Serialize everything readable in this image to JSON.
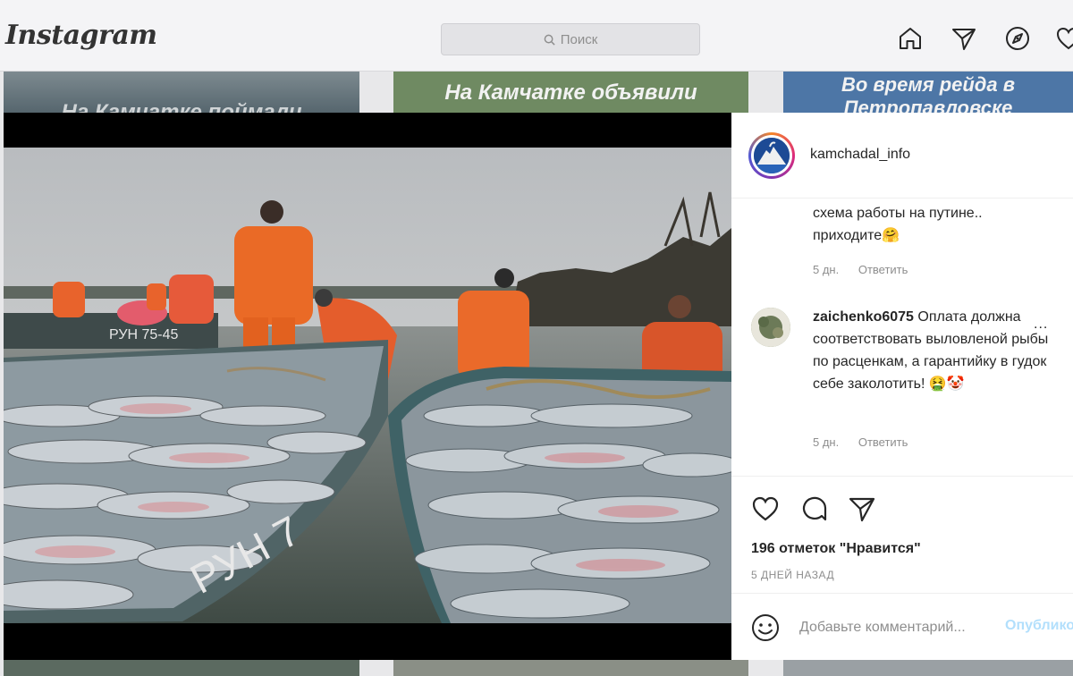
{
  "app": {
    "logo": "Instagram",
    "search_placeholder": "Поиск"
  },
  "nav": {
    "icons": [
      "home-icon",
      "direct-icon",
      "explore-icon",
      "heart-icon"
    ]
  },
  "background_tiles": [
    {
      "text": "На Камчатке поймали"
    },
    {
      "text": "На Камчатке объявили"
    },
    {
      "text": "Во время рейда в Петропавловске"
    }
  ],
  "post": {
    "username": "kamchadal_info",
    "comments": [
      {
        "username": "",
        "text_lines": [
          "схема работы на путине..",
          "приходите🤗"
        ],
        "time": "5 дн.",
        "reply": "Ответить"
      },
      {
        "username": "zaichenko6075",
        "text": "Оплата должна соответствовать выловленой рыбы по расценкам, а гарантийку в гудок себе заколотить! 🤮🤡",
        "time": "5 дн.",
        "reply": "Ответить"
      }
    ],
    "more": "...",
    "likes": "196 отметок \"Нравится\"",
    "date": "5 ДНЕЙ НАЗАД",
    "comment_placeholder": "Добавьте комментарий...",
    "publish": "Опубликовать"
  },
  "photo": {
    "boat_left_label": "РУН 75-45",
    "boat_front_label": "РУН 7"
  },
  "colors": {
    "accent_blue": "#0095f6",
    "publish_disabled": "#b2dffc",
    "gear_orange": "#e8612a",
    "boat_hull": "#4a6468"
  }
}
